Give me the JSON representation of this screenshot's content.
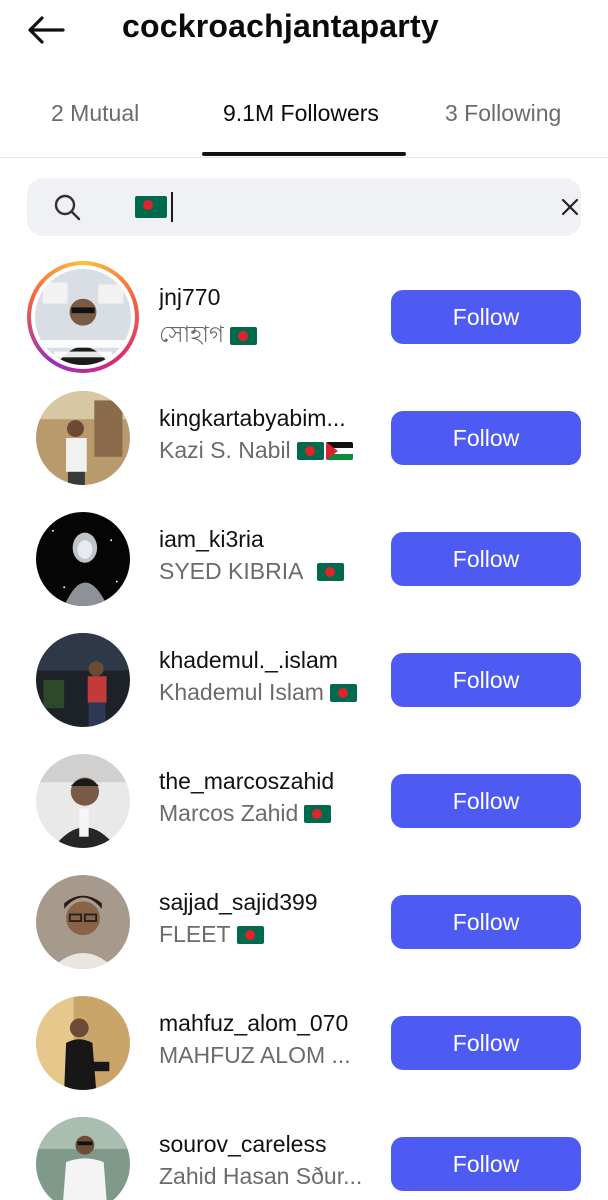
{
  "header": {
    "title": "cockroachjantaparty",
    "back_icon": "arrow-left-icon"
  },
  "tabs": [
    {
      "label": "2 Mutual",
      "active": false
    },
    {
      "label": "9.1M Followers",
      "active": true
    },
    {
      "label": "3 Following",
      "active": false
    }
  ],
  "search": {
    "query_flag": "bangladesh-flag",
    "icon": "search-icon",
    "clear_icon": "close-icon"
  },
  "colors": {
    "accent": "#4e5bf2",
    "story_ring": "#d62976"
  },
  "followers": [
    {
      "username": "jnj770",
      "display_name": "সোহাগ",
      "flags": [
        "bangladesh-flag"
      ],
      "button": "Follow",
      "story": true
    },
    {
      "username": "kingkartabyabim...",
      "display_name": "Kazi S. Nabil",
      "flags": [
        "bangladesh-flag",
        "palestine-flag"
      ],
      "button": "Follow",
      "story": false
    },
    {
      "username": "iam_ki3ria",
      "display_name": "SYED KIBRIA ",
      "flags": [
        "bangladesh-flag"
      ],
      "button": "Follow",
      "story": false
    },
    {
      "username": "khademul._.islam",
      "display_name": "Khademul Islam",
      "flags": [
        "bangladesh-flag"
      ],
      "button": "Follow",
      "story": false
    },
    {
      "username": "the_marcoszahid",
      "display_name": "Marcos Zahid",
      "flags": [
        "bangladesh-flag"
      ],
      "button": "Follow",
      "story": false
    },
    {
      "username": "sajjad_sajid399",
      "display_name": "FLEET",
      "flags": [
        "bangladesh-flag"
      ],
      "button": "Follow",
      "story": false
    },
    {
      "username": "mahfuz_alom_070",
      "display_name": "MAHFUZ ALOM ...",
      "flags": [],
      "button": "Follow",
      "story": false
    },
    {
      "username": "sourov_careless",
      "display_name": "Zahid Hasan Sður...",
      "flags": [],
      "button": "Follow",
      "story": false
    }
  ]
}
